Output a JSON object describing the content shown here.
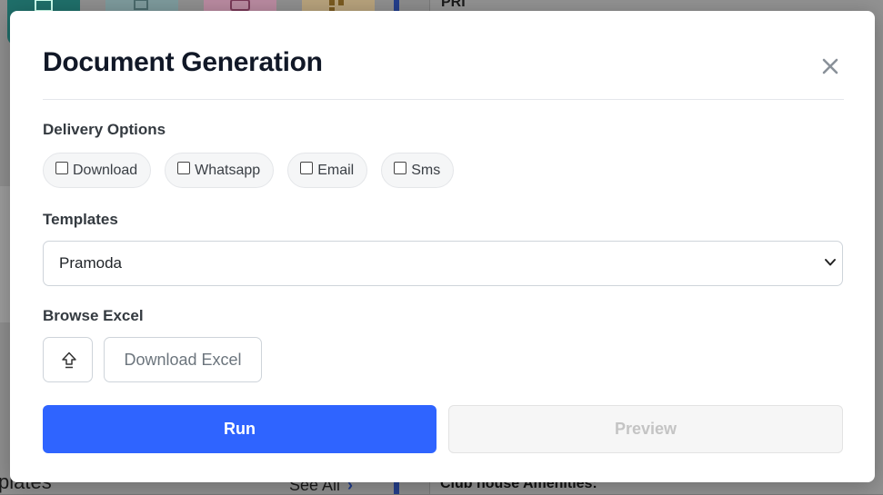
{
  "background": {
    "tile_colors": [
      "#1f6f6a",
      "#7d9a9c",
      "#b98aa0",
      "#b7a27c"
    ],
    "left_bottom_text": "plates",
    "see_all": "See All",
    "right_bottom_text": "Club house Amenities:",
    "right_top_text": "PRI"
  },
  "modal": {
    "title": "Document Generation",
    "delivery": {
      "label": "Delivery Options",
      "options": [
        {
          "label": "Download",
          "checked": false
        },
        {
          "label": "Whatsapp",
          "checked": false
        },
        {
          "label": "Email",
          "checked": false
        },
        {
          "label": "Sms",
          "checked": false
        }
      ]
    },
    "templates": {
      "label": "Templates",
      "selected": "Pramoda"
    },
    "excel": {
      "label": "Browse Excel",
      "download_label": "Download Excel"
    },
    "actions": {
      "run_label": "Run",
      "preview_label": "Preview"
    }
  },
  "colors": {
    "primary": "#2f64ff",
    "disabled_text": "#c4c4c4"
  }
}
